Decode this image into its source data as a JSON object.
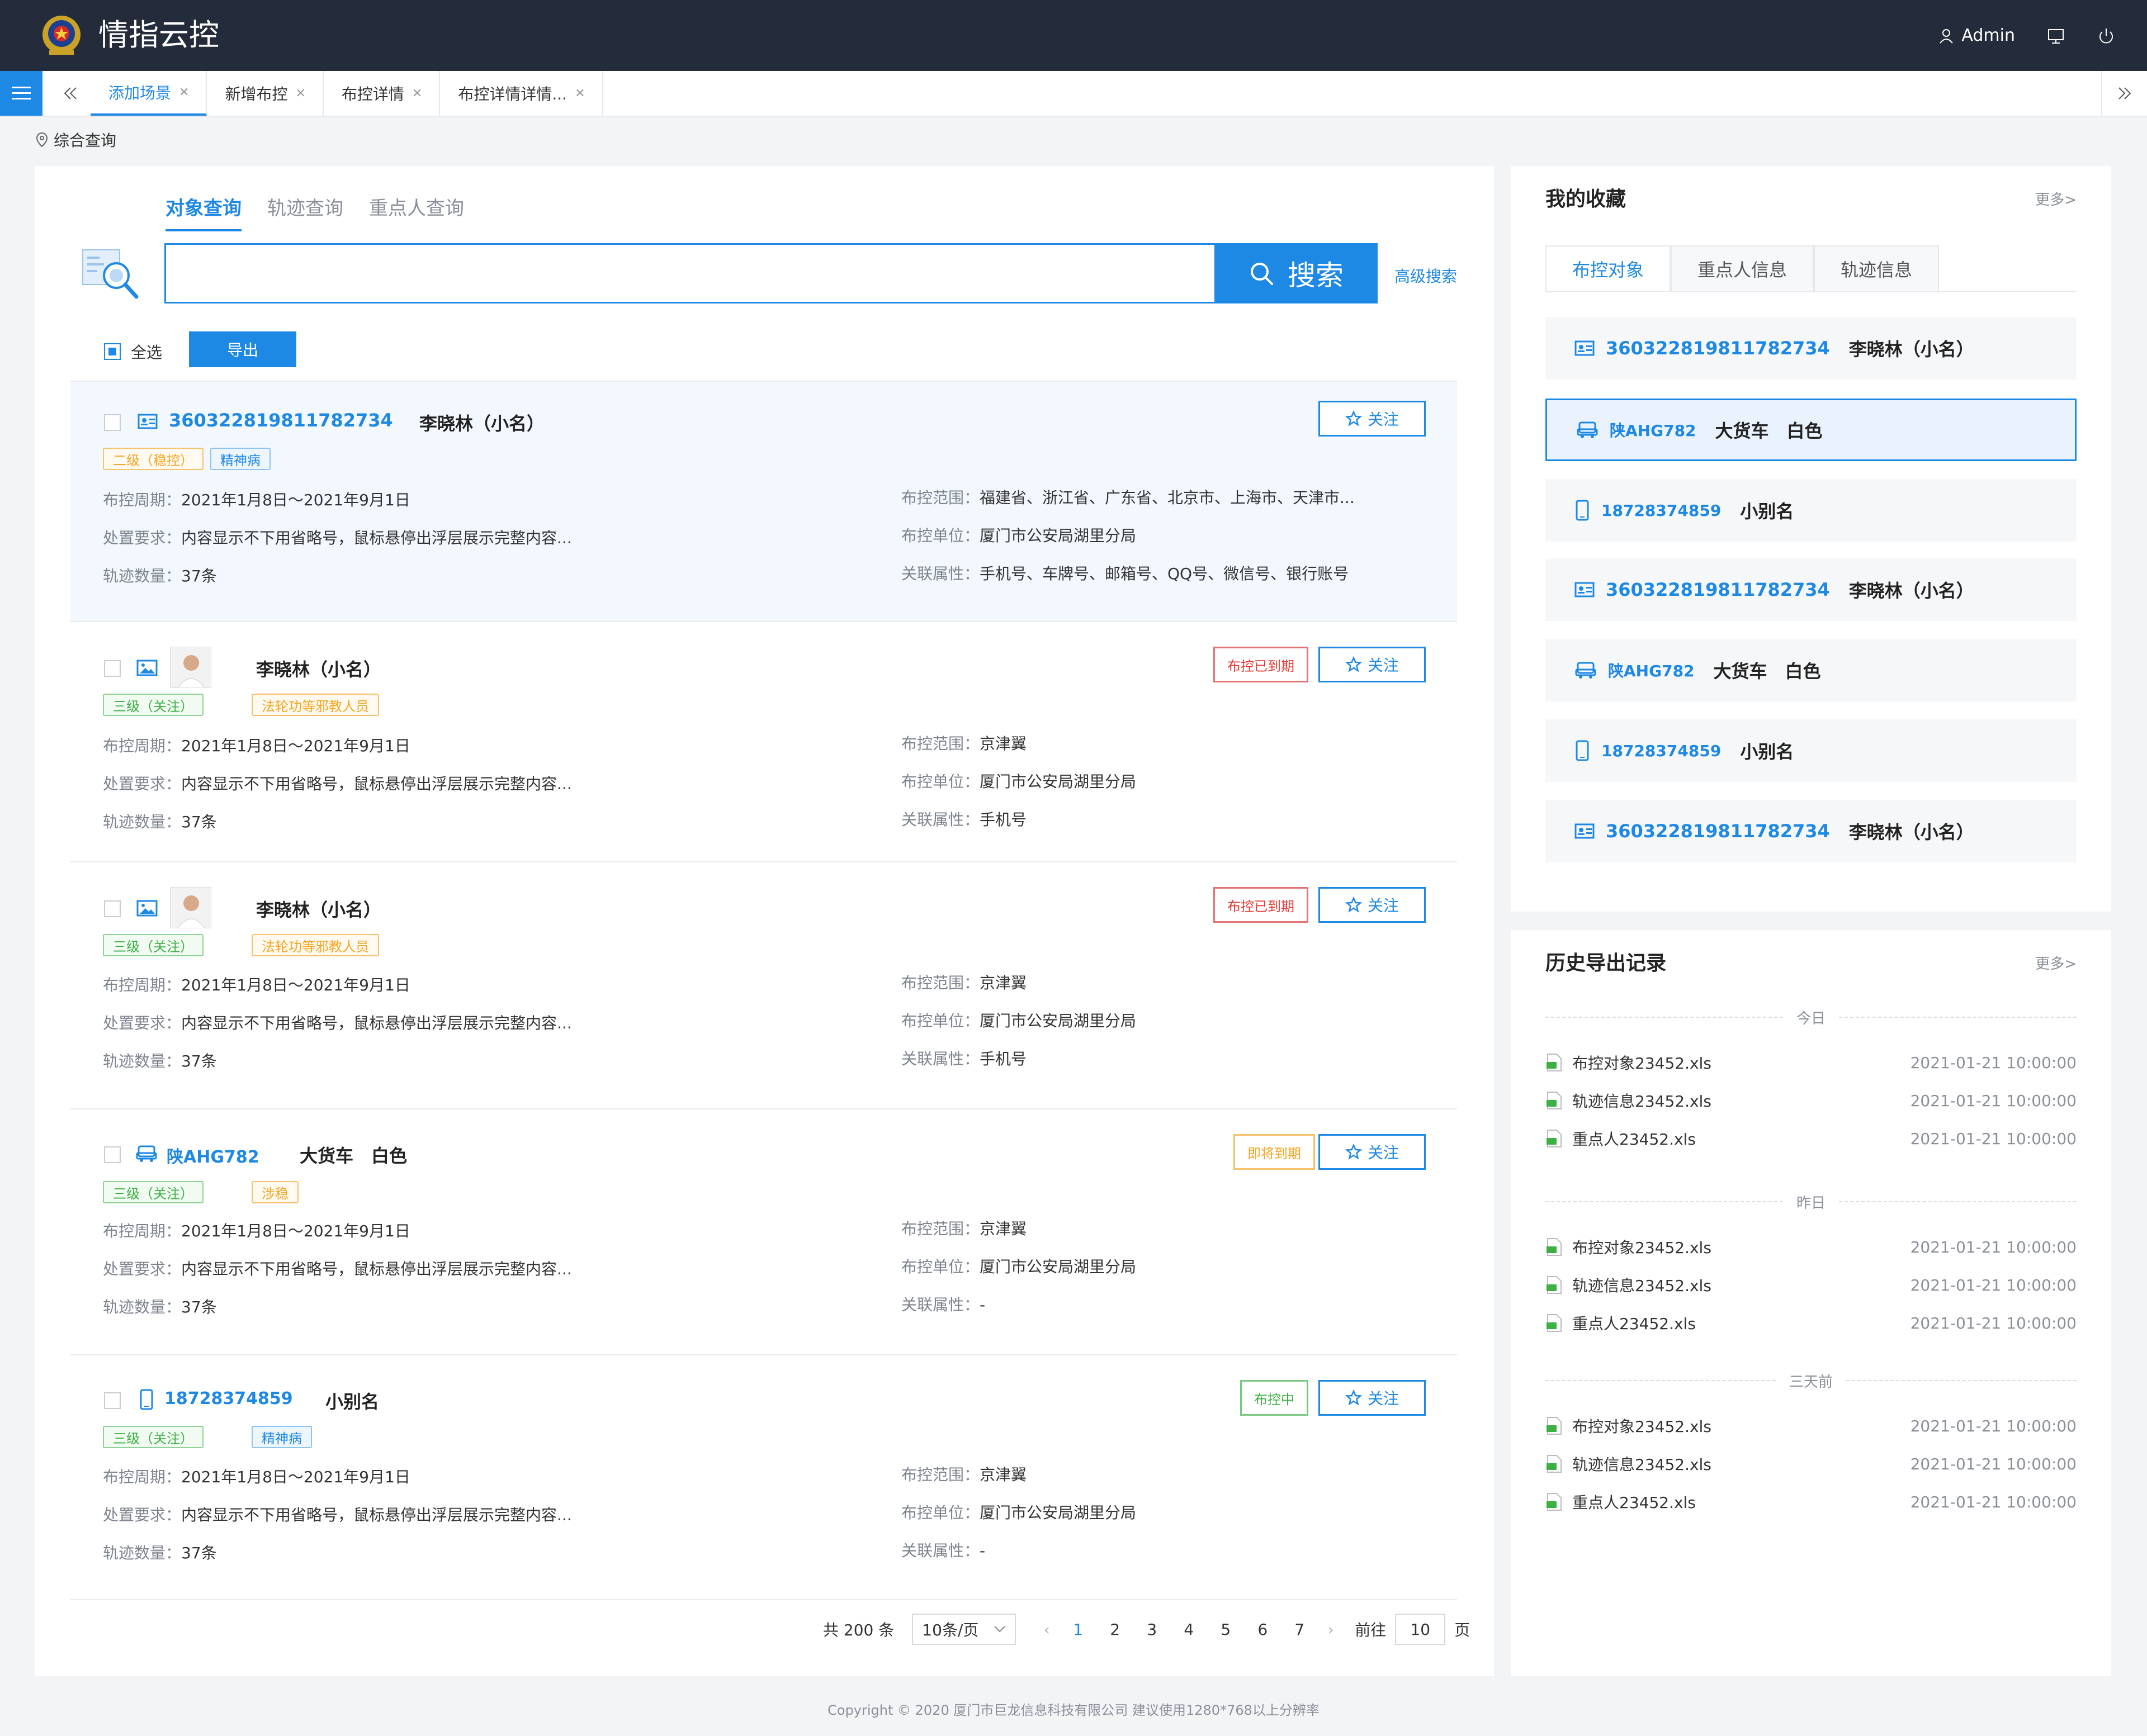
{
  "app": {
    "title": "情指云控",
    "user": "Admin"
  },
  "tabs": [
    {
      "label": "添加场景"
    },
    {
      "label": "新增布控"
    },
    {
      "label": "布控详情"
    },
    {
      "label": "布控详情详情..."
    }
  ],
  "breadcrumb": "综合查询",
  "query": {
    "tabs": [
      "对象查询",
      "轨迹查询",
      "重点人查询"
    ],
    "search_value": "",
    "search_label": "搜索",
    "advanced": "高级搜索",
    "select_all": "全选",
    "export": "导出",
    "follow": "关注"
  },
  "labels": {
    "period": "布控周期：",
    "req": "处置要求：",
    "count": "轨迹数量：",
    "range": "布控范围：",
    "unit": "布控单位：",
    "attr": "关联属性："
  },
  "results": [
    {
      "id": "360322819811782734",
      "name": "李晓林（小名）",
      "tags": [
        "二级（稳控）",
        "精神病"
      ],
      "status": "",
      "period": "2021年1月8日～2021年9月1日",
      "req": "内容显示不下用省略号，鼠标悬停出浮层展示完整内容...",
      "count": "37条",
      "range": "福建省、浙江省、广东省、北京市、上海市、天津市...",
      "unit": "厦门市公安局湖里分局",
      "attr": "手机号、车牌号、邮箱号、QQ号、微信号、银行账号"
    },
    {
      "id": "",
      "name": "李晓林（小名）",
      "tags": [
        "三级（关注）",
        "法轮功等邪教人员"
      ],
      "status": "布控已到期",
      "period": "2021年1月8日～2021年9月1日",
      "req": "内容显示不下用省略号，鼠标悬停出浮层展示完整内容...",
      "count": "37条",
      "range": "京津翼",
      "unit": "厦门市公安局湖里分局",
      "attr": "手机号"
    },
    {
      "id": "",
      "name": "李晓林（小名）",
      "tags": [
        "三级（关注）",
        "法轮功等邪教人员"
      ],
      "status": "布控已到期",
      "period": "2021年1月8日～2021年9月1日",
      "req": "内容显示不下用省略号，鼠标悬停出浮层展示完整内容...",
      "count": "37条",
      "range": "京津翼",
      "unit": "厦门市公安局湖里分局",
      "attr": "手机号"
    },
    {
      "id": "陕AHG782",
      "name": "大货车　白色",
      "tags": [
        "三级（关注）",
        "涉稳"
      ],
      "status": "即将到期",
      "period": "2021年1月8日～2021年9月1日",
      "req": "内容显示不下用省略号，鼠标悬停出浮层展示完整内容...",
      "count": "37条",
      "range": "京津翼",
      "unit": "厦门市公安局湖里分局",
      "attr": "-"
    },
    {
      "id": "18728374859",
      "name": "小别名",
      "tags": [
        "三级（关注）",
        "精神病"
      ],
      "status": "布控中",
      "period": "2021年1月8日～2021年9月1日",
      "req": "内容显示不下用省略号，鼠标悬停出浮层展示完整内容...",
      "count": "37条",
      "range": "京津翼",
      "unit": "厦门市公安局湖里分局",
      "attr": "-"
    }
  ],
  "pager": {
    "total": "共 200 条",
    "size": "10条/页",
    "pages": [
      "1",
      "2",
      "3",
      "4",
      "5",
      "6",
      "7"
    ],
    "goto": "前往",
    "goto_value": "10",
    "page_unit": "页"
  },
  "favorites": {
    "title": "我的收藏",
    "more": "更多>",
    "tabs": [
      "布控对象",
      "重点人信息",
      "轨迹信息"
    ],
    "items": [
      {
        "id": "360322819811782734",
        "name": "李晓林（小名）"
      },
      {
        "id": "陕AHG782",
        "name": "大货车　白色"
      },
      {
        "id": "18728374859",
        "name": "小别名"
      },
      {
        "id": "360322819811782734",
        "name": "李晓林（小名）"
      },
      {
        "id": "陕AHG782",
        "name": "大货车　白色"
      },
      {
        "id": "18728374859",
        "name": "小别名"
      },
      {
        "id": "360322819811782734",
        "name": "李晓林（小名）"
      }
    ]
  },
  "history": {
    "title": "历史导出记录",
    "more": "更多>",
    "sections": [
      {
        "label": "今日",
        "rows": [
          {
            "file": "布控对象23452.xls",
            "time": "2021-01-21  10:00:00"
          },
          {
            "file": "轨迹信息23452.xls",
            "time": "2021-01-21  10:00:00"
          },
          {
            "file": "重点人23452.xls",
            "time": "2021-01-21  10:00:00"
          }
        ]
      },
      {
        "label": "昨日",
        "rows": [
          {
            "file": "布控对象23452.xls",
            "time": "2021-01-21  10:00:00"
          },
          {
            "file": "轨迹信息23452.xls",
            "time": "2021-01-21  10:00:00"
          },
          {
            "file": "重点人23452.xls",
            "time": "2021-01-21  10:00:00"
          }
        ]
      },
      {
        "label": "三天前",
        "rows": [
          {
            "file": "布控对象23452.xls",
            "time": "2021-01-21  10:00:00"
          },
          {
            "file": "轨迹信息23452.xls",
            "time": "2021-01-21  10:00:00"
          },
          {
            "file": "重点人23452.xls",
            "time": "2021-01-21  10:00:00"
          }
        ]
      }
    ]
  },
  "footer": "Copyright © 2020  厦门市巨龙信息科技有限公司  建议使用1280*768以上分辨率",
  "colors": {
    "primary": "#1e88e5",
    "header": "#242b3b",
    "danger": "#e53935",
    "warning": "#f5a623",
    "success": "#3cb043"
  }
}
